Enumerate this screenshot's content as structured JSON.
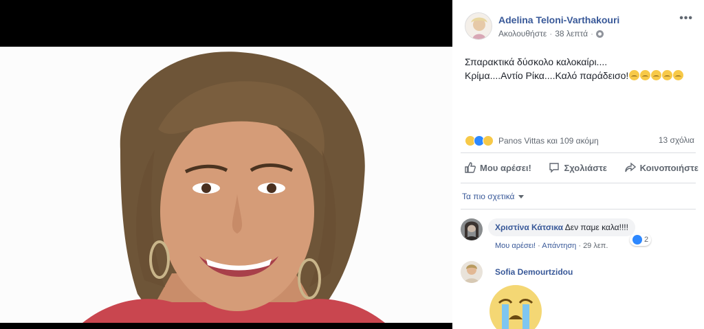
{
  "post": {
    "author": "Adelina Teloni-Varthakouri",
    "follow_label": "Ακολουθήστε",
    "time": "38 λεπτά",
    "more_label": "•••",
    "text_line1": "Σπαρακτικά δύσκολο καλοκαίρι....",
    "text_line2": "Κρίμα....Αντίο Ρίκα....Καλό παράδεισο!",
    "emoji_count": 5
  },
  "reactions": {
    "icons": [
      "sad-icon",
      "like-icon",
      "wow-icon"
    ],
    "summary": "Panos Vittas και 109 ακόμη",
    "comments_count": "13 σχόλια"
  },
  "actions": {
    "like": "Μου αρέσει!",
    "comment": "Σχολιάστε",
    "share": "Κοινοποιήστε"
  },
  "comments_filter": "Τα πιο σχετικά",
  "comments": [
    {
      "name": "Χριστίνα Κάτσικα",
      "text": "Δεν παμε καλα!!!!",
      "like": "Μου αρέσει!",
      "reply": "Απάντηση",
      "time": "29 λεπ.",
      "reaction_count": "2"
    },
    {
      "name": "Sofia Demourtzidou",
      "sticker": "crying-sticker"
    }
  ],
  "colors": {
    "link": "#385898",
    "meta": "#606770",
    "like_blue": "#2d88ff",
    "emoji_yellow": "#f7c948"
  }
}
